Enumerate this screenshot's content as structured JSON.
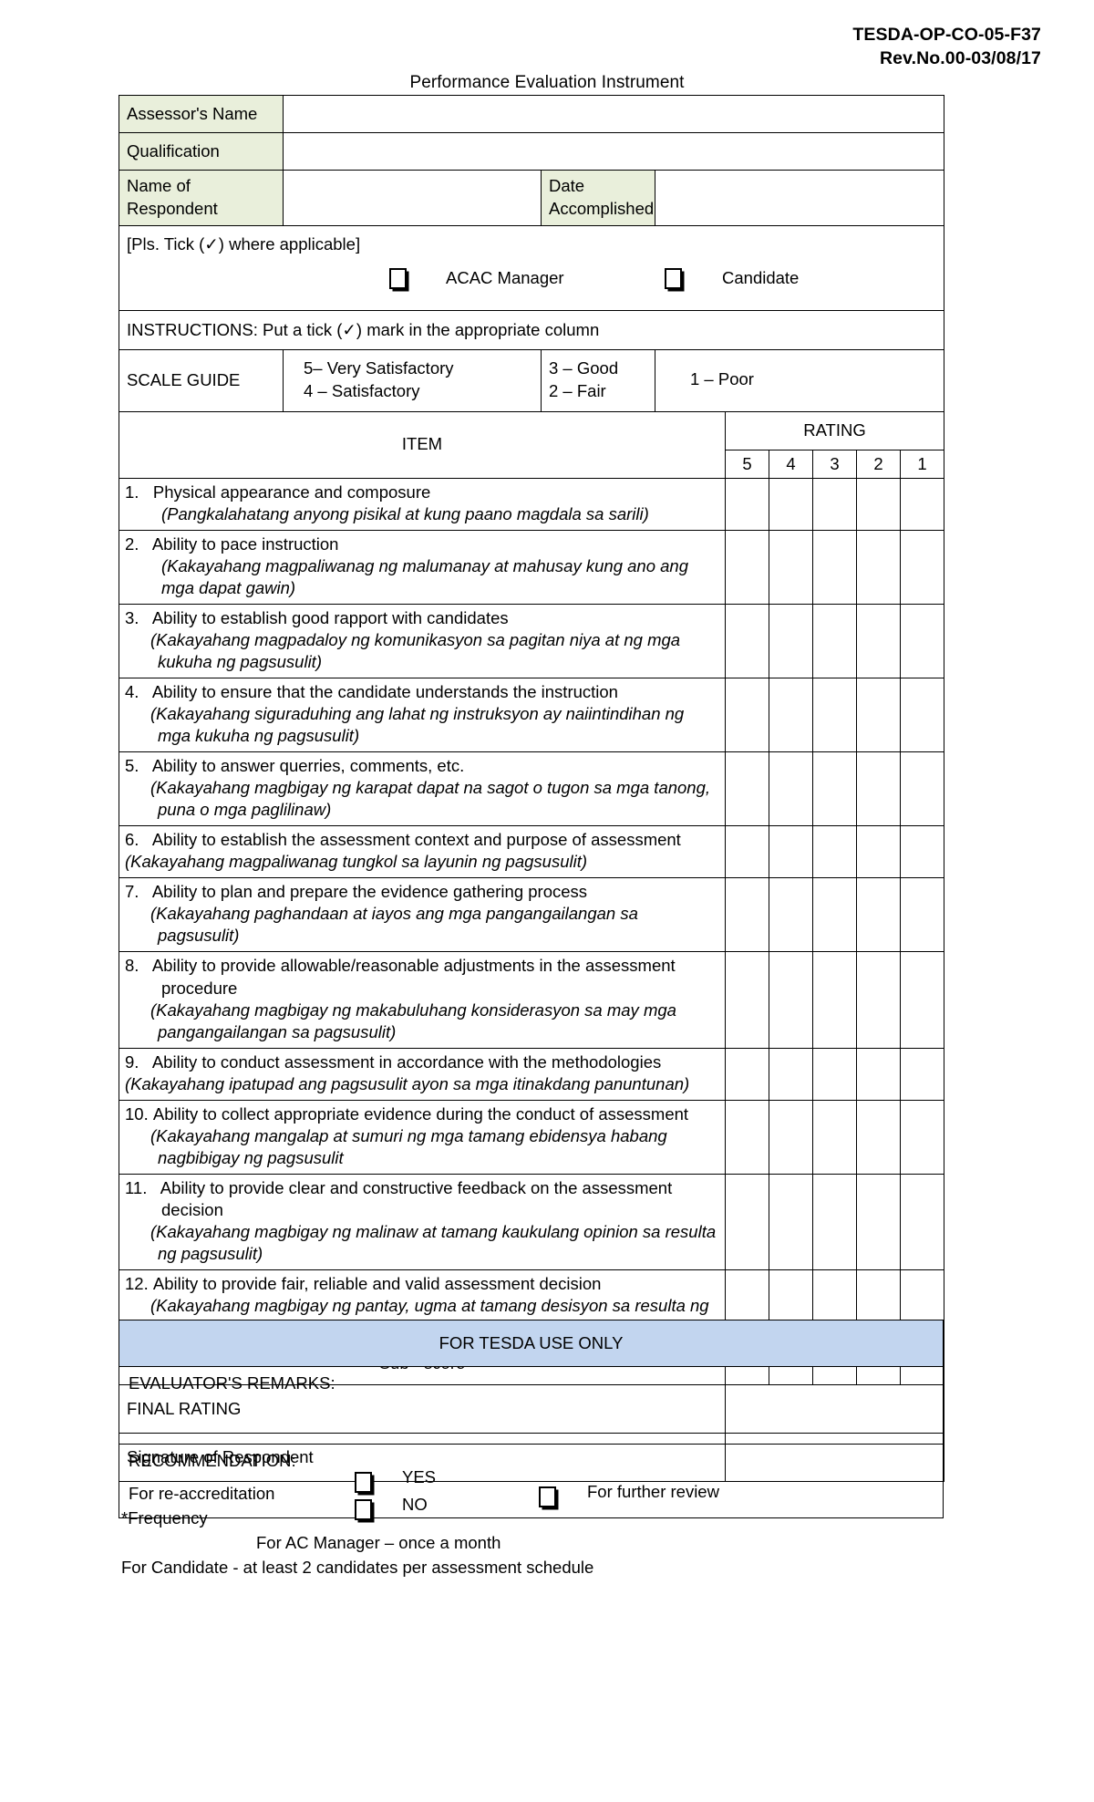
{
  "header": {
    "doc_code": "TESDA-OP-CO-05-F37",
    "revision": "Rev.No.00-03/08/17",
    "form_title": "Performance Evaluation Instrument"
  },
  "identity": {
    "assessor_label": "Assessor's Name",
    "assessor_value": "",
    "qualification_label": "Qualification",
    "qualification_value": "",
    "respondent_label": "Name of Respondent",
    "respondent_value": "",
    "date_label": "Date Accomplished",
    "date_value": ""
  },
  "tick": {
    "note": "[Pls. Tick (✓) where applicable]",
    "option_a": "ACAC Manager",
    "option_b": "Candidate",
    "checkbox_icon": "empty-checkbox"
  },
  "instructions": {
    "text": "INSTRUCTIONS:  Put a tick (✓) mark in the appropriate column"
  },
  "scale_guide": {
    "label": "SCALE GUIDE",
    "col1_line1": "5– Very Satisfactory",
    "col1_line2": "4 – Satisfactory",
    "col2_line1": "3 – Good",
    "col2_line2": "2 – Fair",
    "col3_line1": "1 – Poor"
  },
  "table": {
    "item_header": "ITEM",
    "rating_header": "RATING",
    "rating_columns": [
      "5",
      "4",
      "3",
      "2",
      "1"
    ],
    "subscore_label": "Sub - score",
    "final_rating_label": "FINAL RATING",
    "final_rating_value": "",
    "signature_label": "Signature of Respondent",
    "signature_value": "",
    "items": [
      {
        "number": "1.",
        "english": "Physical appearance and composure",
        "tagalog": "(Pangkalahatang anyong pisikal at kung paano magdala sa sarili)"
      },
      {
        "number": "2.",
        "english": "Ability to pace instruction",
        "tagalog": "(Kakayahang magpaliwanag ng malumanay at mahusay kung ano ang mga dapat gawin)"
      },
      {
        "number": "3.",
        "english": "Ability to establish good rapport with candidates",
        "tagalog": "(Kakayahang magpadaloy ng komunikasyon sa pagitan niya at ng mga kukuha ng pagsusulit)"
      },
      {
        "number": "4.",
        "english": "Ability to ensure that the candidate understands the instruction",
        "tagalog": "(Kakayahang siguraduhing ang lahat ng instruksyon ay naiintindihan ng mga kukuha ng pagsusulit)"
      },
      {
        "number": "5.",
        "english": "Ability to answer querries, comments, etc.",
        "tagalog": "(Kakayahang magbigay ng karapat dapat na sagot o tugon sa mga tanong, puna o mga paglilinaw)"
      },
      {
        "number": "6.",
        "english": "Ability to establish the assessment context and purpose of assessment",
        "tagalog": "(Kakayahang magpaliwanag tungkol sa layunin ng pagsusulit)"
      },
      {
        "number": "7.",
        "english": "Ability to plan and prepare the evidence gathering process",
        "tagalog": "(Kakayahang paghandaan at iayos ang mga pangangailangan sa pagsusulit)"
      },
      {
        "number": "8.",
        "english": "Ability to provide allowable/reasonable adjustments in the assessment procedure",
        "tagalog": "(Kakayahang magbigay ng makabuluhang konsiderasyon sa may mga pangangailangan sa pagsusulit)"
      },
      {
        "number": "9.",
        "english": "Ability to conduct assessment in accordance with the methodologies",
        "tagalog": "(Kakayahang ipatupad ang pagsusulit ayon sa mga itinakdang panuntunan)"
      },
      {
        "number": "10.",
        "english": "Ability to   collect appropriate evidence during the   conduct of assessment",
        "tagalog": "(Kakayahang mangalap at sumuri ng mga tamang ebidensya habang nagbibigay  ng pagsusulit"
      },
      {
        "number": "11.",
        "english": "Ability to provide clear and constructive feedback on the assessment decision",
        "tagalog": "(Kakayahang magbigay ng malinaw at tamang kaukulang opinion sa resulta ng pagsusulit)"
      },
      {
        "number": "12.",
        "english": "Ability to provide fair, reliable and valid assessment decision",
        "tagalog": "(Kakayahang magbigay ng pantay, ugma at tamang desisyon sa resulta ng pagsusulit)"
      }
    ]
  },
  "tesda_block": {
    "title": "FOR TESDA USE ONLY",
    "remarks_label": "EVALUATOR'S REMARKS:",
    "remarks_value": "",
    "recommendation_label": "RECOMMENDATION:",
    "reaccreditation_label": "For re-accreditation",
    "yes_label": "YES",
    "no_label": "NO",
    "further_review_label": "For further review"
  },
  "footer": {
    "frequency": "*Frequency",
    "line_manager": "For AC Manager – once a month",
    "line_candidate": "For Candidate - at least 2 candidates per assessment schedule"
  },
  "colors": {
    "label_fill": "#e9efdb",
    "tesda_fill": "#c2d5ef",
    "border": "#000000"
  }
}
